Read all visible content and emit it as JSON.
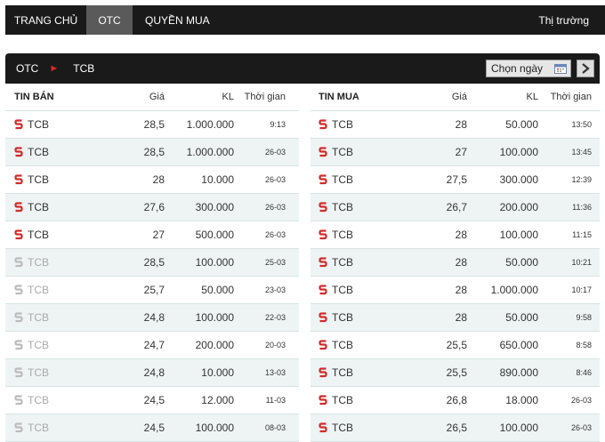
{
  "nav": {
    "items": [
      "TRANG CHỦ",
      "OTC",
      "QUYỀN MUA"
    ],
    "right": "Thị trường"
  },
  "panel": {
    "crumb_root": "OTC",
    "crumb_current": "TCB",
    "date_placeholder": "Chọn ngày"
  },
  "sell": {
    "headers": [
      "TIN BÁN",
      "Giá",
      "KL",
      "Thời gian"
    ],
    "rows": [
      {
        "symbol": "TCB",
        "price": "28,5",
        "volume": "1.000.000",
        "time": "9:13",
        "active": true
      },
      {
        "symbol": "TCB",
        "price": "28,5",
        "volume": "1.000.000",
        "time": "26-03",
        "active": true
      },
      {
        "symbol": "TCB",
        "price": "28",
        "volume": "10.000",
        "time": "26-03",
        "active": true
      },
      {
        "symbol": "TCB",
        "price": "27,6",
        "volume": "300.000",
        "time": "26-03",
        "active": true
      },
      {
        "symbol": "TCB",
        "price": "27",
        "volume": "500.000",
        "time": "26-03",
        "active": true
      },
      {
        "symbol": "TCB",
        "price": "28,5",
        "volume": "100.000",
        "time": "25-03",
        "active": false
      },
      {
        "symbol": "TCB",
        "price": "25,7",
        "volume": "50.000",
        "time": "23-03",
        "active": false
      },
      {
        "symbol": "TCB",
        "price": "24,8",
        "volume": "100.000",
        "time": "22-03",
        "active": false
      },
      {
        "symbol": "TCB",
        "price": "24,7",
        "volume": "200.000",
        "time": "20-03",
        "active": false
      },
      {
        "symbol": "TCB",
        "price": "24,8",
        "volume": "10.000",
        "time": "13-03",
        "active": false
      },
      {
        "symbol": "TCB",
        "price": "24,5",
        "volume": "12.000",
        "time": "11-03",
        "active": false
      },
      {
        "symbol": "TCB",
        "price": "24,5",
        "volume": "100.000",
        "time": "08-03",
        "active": false
      }
    ]
  },
  "buy": {
    "headers": [
      "TIN MUA",
      "Giá",
      "KL",
      "Thời gian"
    ],
    "rows": [
      {
        "symbol": "TCB",
        "price": "28",
        "volume": "50.000",
        "time": "13:50",
        "active": true
      },
      {
        "symbol": "TCB",
        "price": "27",
        "volume": "100.000",
        "time": "13:45",
        "active": true
      },
      {
        "symbol": "TCB",
        "price": "27,5",
        "volume": "300.000",
        "time": "12:39",
        "active": true
      },
      {
        "symbol": "TCB",
        "price": "26,7",
        "volume": "200.000",
        "time": "11:36",
        "active": true
      },
      {
        "symbol": "TCB",
        "price": "28",
        "volume": "100.000",
        "time": "11:15",
        "active": true
      },
      {
        "symbol": "TCB",
        "price": "28",
        "volume": "50.000",
        "time": "10:21",
        "active": true
      },
      {
        "symbol": "TCB",
        "price": "28",
        "volume": "1.000.000",
        "time": "10:17",
        "active": true
      },
      {
        "symbol": "TCB",
        "price": "28",
        "volume": "50.000",
        "time": "9:58",
        "active": true
      },
      {
        "symbol": "TCB",
        "price": "25,5",
        "volume": "650.000",
        "time": "8:58",
        "active": true
      },
      {
        "symbol": "TCB",
        "price": "25,5",
        "volume": "890.000",
        "time": "8:46",
        "active": true
      },
      {
        "symbol": "TCB",
        "price": "26,8",
        "volume": "18.000",
        "time": "26-03",
        "active": true
      },
      {
        "symbol": "TCB",
        "price": "26,5",
        "volume": "100.000",
        "time": "26-03",
        "active": true
      }
    ]
  },
  "colors": {
    "accent_red": "#d42a2a",
    "dim_icon": "#bbbbbb",
    "header_bg": "#1a1a1a",
    "row_alt": "#eef4f4"
  },
  "icons": {
    "stock": "s-logo-icon",
    "calendar": "calendar-icon",
    "next": "chevron-right-icon",
    "breadcrumb": "caret-right-icon"
  }
}
